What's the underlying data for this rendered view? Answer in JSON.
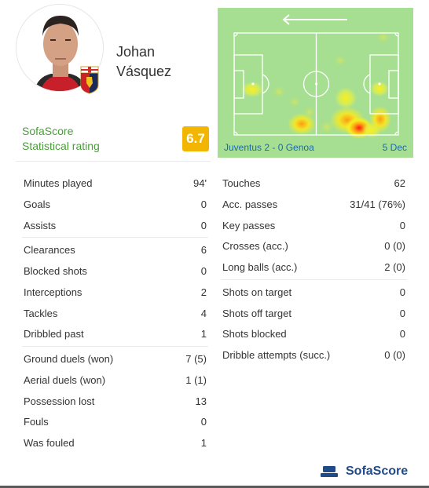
{
  "player": {
    "first_name": "Johan",
    "last_name": "Vásquez",
    "team_badge_icon": "genoa-crest-icon"
  },
  "rating": {
    "label_line1": "SofaScore",
    "label_line2": "Statistical rating",
    "value": "6.7",
    "color": "#f2b500"
  },
  "heatmap": {
    "direction_icon": "arrow-left-icon",
    "match": "Juventus 2 - 0 Genoa",
    "date": "5 Dec",
    "background": "#a6df91"
  },
  "stats_left": [
    {
      "label": "Minutes played",
      "value": "94'"
    },
    {
      "label": "Goals",
      "value": "0"
    },
    {
      "label": "Assists",
      "value": "0"
    },
    {
      "label": "Clearances",
      "value": "6"
    },
    {
      "label": "Blocked shots",
      "value": "0"
    },
    {
      "label": "Interceptions",
      "value": "2"
    },
    {
      "label": "Tackles",
      "value": "4"
    },
    {
      "label": "Dribbled past",
      "value": "1"
    },
    {
      "label": "Ground duels (won)",
      "value": "7 (5)"
    },
    {
      "label": "Aerial duels (won)",
      "value": "1 (1)"
    },
    {
      "label": "Possession lost",
      "value": "13"
    },
    {
      "label": "Fouls",
      "value": "0"
    },
    {
      "label": "Was fouled",
      "value": "1"
    }
  ],
  "stats_right": [
    {
      "label": "Touches",
      "value": "62"
    },
    {
      "label": "Acc. passes",
      "value": "31/41 (76%)"
    },
    {
      "label": "Key passes",
      "value": "0"
    },
    {
      "label": "Crosses (acc.)",
      "value": "0 (0)"
    },
    {
      "label": "Long balls (acc.)",
      "value": "2 (0)"
    },
    {
      "label": "Shots on target",
      "value": "0"
    },
    {
      "label": "Shots off target",
      "value": "0"
    },
    {
      "label": "Shots blocked",
      "value": "0"
    },
    {
      "label": "Dribble attempts (succ.)",
      "value": "0 (0)"
    }
  ],
  "footer": {
    "brand": "SofaScore",
    "logo_icon": "sofa-icon",
    "brand_color": "#1f4c89"
  }
}
